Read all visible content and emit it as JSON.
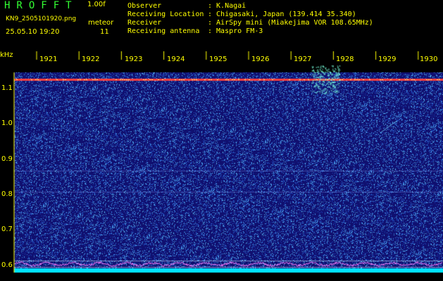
{
  "header": {
    "app_title": "HROFFT",
    "version": "1.00f",
    "filename": "KN9_2505101920.png",
    "datetime": "25.05.10 19:20",
    "meteor_label": "meteor",
    "meteor_count": "11"
  },
  "info": [
    {
      "key": "Observer",
      "value": ": K.Nagai"
    },
    {
      "key": "Receiving Location",
      "value": ": Chigasaki, Japan (139.414 35.340)"
    },
    {
      "key": "Receiver",
      "value": ": AirSpy mini (Miakejima VOR 108.65MHz)"
    },
    {
      "key": "Receiving antenna",
      "value": ": Maspro FM-3"
    }
  ],
  "spectrogram": {
    "y_unit": "kHz",
    "y_ticks": [
      "1.1",
      "1.0",
      "0.9",
      "0.8",
      "0.7",
      "0.6"
    ],
    "x_ticks": [
      "1921",
      "1922",
      "1923",
      "1924",
      "1925",
      "1926",
      "1927",
      "1928",
      "1929",
      "1930"
    ],
    "carrier_freq_khz": 1.13,
    "colors": {
      "background": "#101070",
      "carrier": "#ff4040",
      "noise": "#4da0ff",
      "baseline": "#00e5ff",
      "axis": "#ffff00"
    }
  }
}
